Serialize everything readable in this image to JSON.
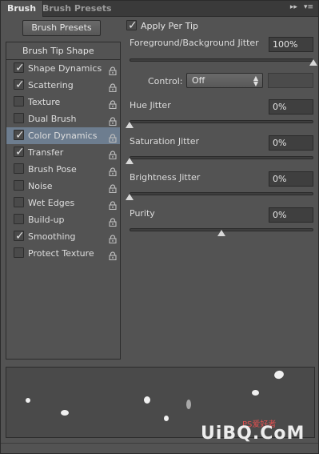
{
  "tabs": [
    {
      "label": "Brush",
      "active": true
    },
    {
      "label": "Brush Presets",
      "active": false
    }
  ],
  "tab_icons": [
    "collapse-icon",
    "panel-menu-icon"
  ],
  "brush_presets_button": "Brush Presets",
  "list": {
    "header": "Brush Tip Shape",
    "items": [
      {
        "label": "Shape Dynamics",
        "checked": true,
        "selected": false
      },
      {
        "label": "Scattering",
        "checked": true,
        "selected": false
      },
      {
        "label": "Texture",
        "checked": false,
        "selected": false
      },
      {
        "label": "Dual Brush",
        "checked": false,
        "selected": false
      },
      {
        "label": "Color Dynamics",
        "checked": true,
        "selected": true
      },
      {
        "label": "Transfer",
        "checked": true,
        "selected": false
      },
      {
        "label": "Brush Pose",
        "checked": false,
        "selected": false
      },
      {
        "label": "Noise",
        "checked": false,
        "selected": false
      },
      {
        "label": "Wet Edges",
        "checked": false,
        "selected": false
      },
      {
        "label": "Build-up",
        "checked": false,
        "selected": false
      },
      {
        "label": "Smoothing",
        "checked": true,
        "selected": false
      },
      {
        "label": "Protect Texture",
        "checked": false,
        "selected": false
      }
    ]
  },
  "settings": {
    "apply_per_tip": {
      "label": "Apply Per Tip",
      "checked": true
    },
    "fg_bg_jitter": {
      "label": "Foreground/Background Jitter",
      "value": "100%",
      "level": 1.0
    },
    "control": {
      "label": "Control:",
      "value": "Off"
    },
    "hue_jitter": {
      "label": "Hue Jitter",
      "value": "0%",
      "level": 0.0
    },
    "saturation_jitter": {
      "label": "Saturation Jitter",
      "value": "0%",
      "level": 0.0
    },
    "brightness_jitter": {
      "label": "Brightness Jitter",
      "value": "0%",
      "level": 0.0
    },
    "purity": {
      "label": "Purity",
      "value": "0%",
      "level": 0.5
    }
  },
  "watermark": {
    "text": "UiBQ.CoM",
    "small": "PS爱好者"
  },
  "colors": {
    "panel": "#535353",
    "selected": "#6d7d8f",
    "tab_bar": "#3a3a3a"
  }
}
